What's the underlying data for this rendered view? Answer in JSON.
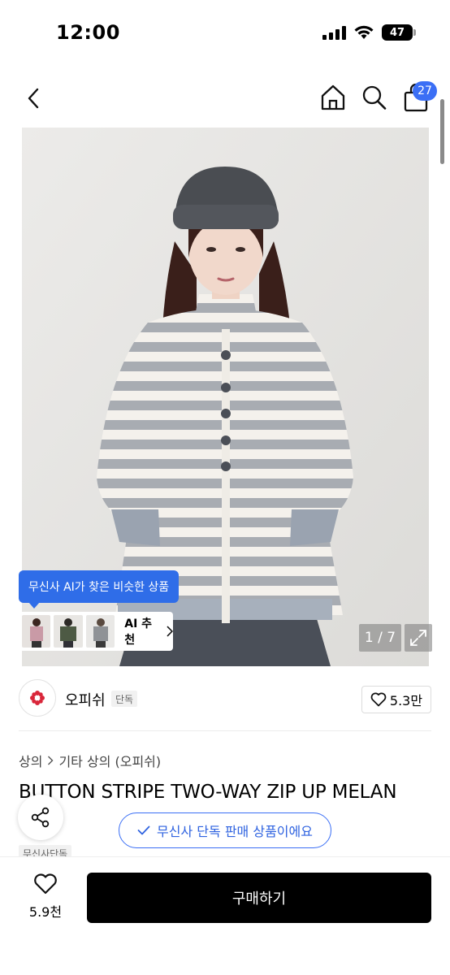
{
  "status_bar": {
    "time": "12:00",
    "battery": "47",
    "battery_level": 0.47
  },
  "nav": {
    "cart_count": "27"
  },
  "hero": {
    "counter": "1 / 7"
  },
  "ai": {
    "tooltip": "무신사 AI가 찾은 비슷한 상품",
    "recommend_label": "AI 추천"
  },
  "brand": {
    "name": "오피쉬",
    "badge": "단독",
    "likes": "5.3만"
  },
  "breadcrumb": {
    "category": "상의",
    "subcategory": "기타 상의 (오피쉬)"
  },
  "product": {
    "title": "BUTTON STRIPE TWO-WAY ZIP UP MELAN",
    "exclusive_notice": "무신사 단독 판매 상품이에요",
    "tag": "무신사단독"
  },
  "bottom": {
    "wish_count": "5.9천",
    "buy_label": "구매하기"
  },
  "colors": {
    "accent_blue": "#3b6ff5",
    "brand_red": "#d9263a"
  }
}
